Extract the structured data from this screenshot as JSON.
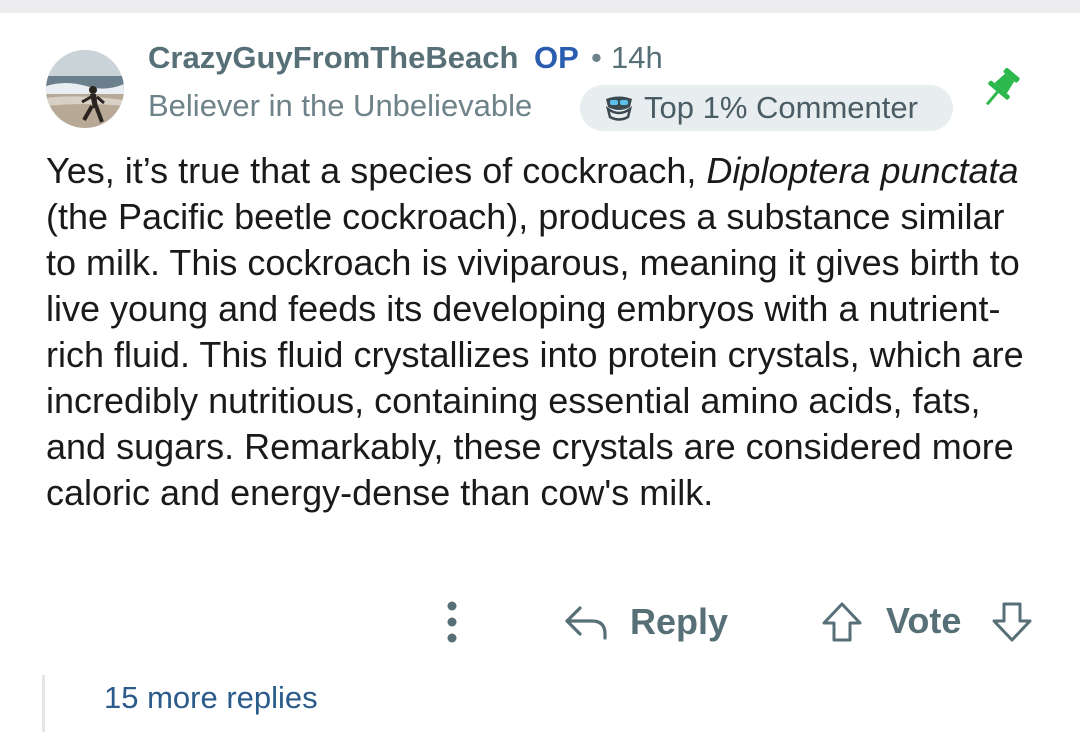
{
  "comment": {
    "username": "CrazyGuyFromTheBeach",
    "op_tag": "OP",
    "separator": "•",
    "timestamp": "14h",
    "user_flair": "Believer in the Unbelievable",
    "badge": {
      "label": "Top 1% Commenter",
      "icon": "top-commenter-icon"
    },
    "pinned_icon": "pin-icon",
    "avatar_icon": "beach-avatar",
    "body": {
      "intro": "Yes, it’s true that a species of cockroach, ",
      "species_name": "Diploptera punctata",
      "rest": " (the Pacific beetle cockroach), produces a substance similar to milk. This cockroach is viviparous, meaning it gives birth to live young and feeds its developing embryos with a nutrient-rich fluid. This fluid crystallizes into protein crystals, which are incredibly nutritious, containing essential amino acids, fats, and sugars. Remarkably, these crystals are considered more caloric and energy-dense than cow's milk."
    },
    "actions": {
      "more_icon": "vertical-ellipsis-icon",
      "reply_icon": "reply-arrow-icon",
      "reply_label": "Reply",
      "upvote_icon": "upvote-arrow-icon",
      "vote_label": "Vote",
      "downvote_icon": "downvote-arrow-icon"
    },
    "more_replies": "15 more replies"
  },
  "colors": {
    "op_blue": "#2a5db0",
    "muted_text": "#576f76",
    "pin_green": "#2db84d",
    "badge_bg": "#e8edf0",
    "link_blue": "#2a5b8a"
  }
}
